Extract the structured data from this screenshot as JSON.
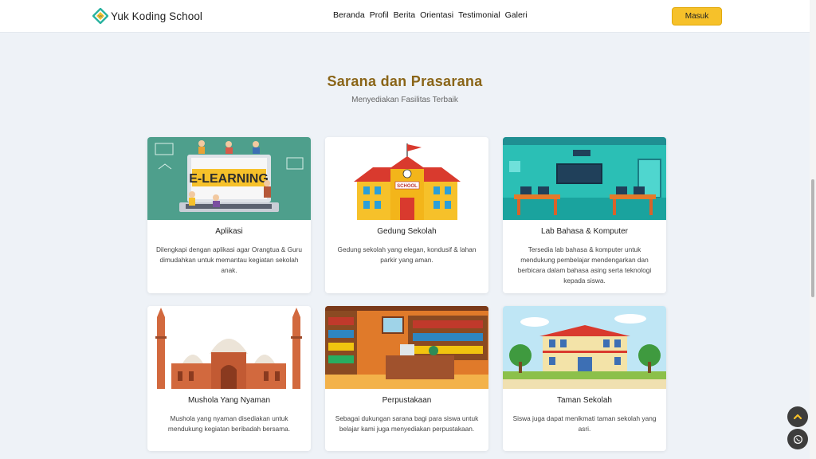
{
  "header": {
    "brand": "Yuk Koding School",
    "nav": [
      "Beranda",
      "Profil",
      "Berita",
      "Orientasi",
      "Testimonial",
      "Galeri"
    ],
    "login_label": "Masuk"
  },
  "section": {
    "title": "Sarana dan Prasarana",
    "subtitle": "Menyediakan Fasilitas Terbaik"
  },
  "cards": [
    {
      "title": "Aplikasi",
      "text": "Dilengkapi dengan aplikasi agar Orangtua & Guru dimudahkan untuk memantau kegiatan sekolah anak.",
      "banner": "E-LEARNING"
    },
    {
      "title": "Gedung Sekolah",
      "text": "Gedung sekolah yang elegan, kondusif & lahan parkir yang aman.",
      "banner": "SCHOOL"
    },
    {
      "title": "Lab Bahasa & Komputer",
      "text": "Tersedia lab bahasa & komputer untuk mendukung pembelajar mendengarkan dan berbicara dalam bahasa asing serta teknologi kepada siswa."
    },
    {
      "title": "Mushola Yang Nyaman",
      "text": "Mushola yang nyaman disediakan untuk mendukung kegiatan beribadah bersama."
    },
    {
      "title": "Perpustakaan",
      "text": "Sebagai dukungan sarana bagi para siswa untuk belajar kami juga menyediakan perpustakaan."
    },
    {
      "title": "Taman Sekolah",
      "text": "Siswa juga dapat menikmati taman sekolah yang asri."
    }
  ],
  "floating": {
    "up_icon": "chevron-up-icon",
    "chat_icon": "whatsapp-icon"
  },
  "colors": {
    "accent": "#f6c12a",
    "title": "#8a6518",
    "fab": "#3d3d3d"
  }
}
